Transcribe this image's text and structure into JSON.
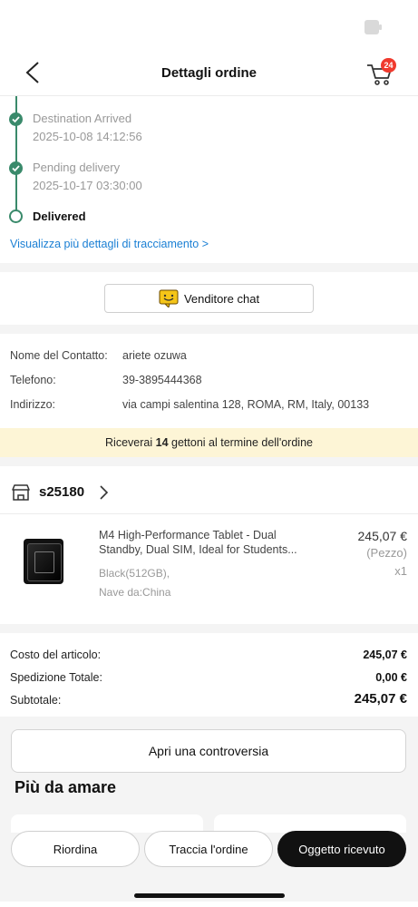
{
  "status_bar": {
    "battery_icon": "battery-icon"
  },
  "header": {
    "title": "Dettagli ordine",
    "cart_badge": "24"
  },
  "tracking": {
    "steps": [
      {
        "label": "Destination Arrived",
        "time": "2025-10-08 14:12:56"
      },
      {
        "label": "Pending delivery",
        "time": "2025-10-17 03:30:00"
      },
      {
        "label": "Delivered"
      }
    ],
    "more_link": "Visualizza più dettagli di tracciamento >"
  },
  "seller_chat": {
    "label": "Venditore chat"
  },
  "contact": {
    "name_label": "Nome del Contatto:",
    "name_value": "ariete ozuwa",
    "phone_label": "Telefono:",
    "phone_value": "39-3895444368",
    "address_label": "Indirizzo:",
    "address_value": "via campi salentina 128, ROMA, RM, Italy, 00133"
  },
  "tokens_banner": {
    "prefix": "Riceverai",
    "count": "14",
    "suffix": "gettoni al termine dell'ordine"
  },
  "shop": {
    "name": "s25180"
  },
  "product": {
    "title_line1": "M4 High-Performance Tablet - Dual",
    "title_line2": "Standby, Dual SIM, Ideal for Students...",
    "variant": "Black(512GB),",
    "ship_from": "Nave da:China",
    "price": "245,07 €",
    "unit": "(Pezzo)",
    "qty": "x1"
  },
  "summary": {
    "item_cost_label": "Costo del articolo:",
    "item_cost": "245,07 €",
    "shipping_label": "Spedizione Totale:",
    "shipping": "0,00 €",
    "subtotal_label": "Subtotale:",
    "subtotal": "245,07 €"
  },
  "dispute_button": "Apri una controversia",
  "more_to_love": "Più da amare",
  "bottom_bar": {
    "reorder": "Riordina",
    "track": "Traccia l'ordine",
    "received": "Oggetto ricevuto"
  },
  "colors": {
    "accent_green": "#3a8a6b",
    "link_blue": "#1a7fd4",
    "banner_yellow": "#fdf5d6",
    "badge_red": "#f03a2e"
  }
}
